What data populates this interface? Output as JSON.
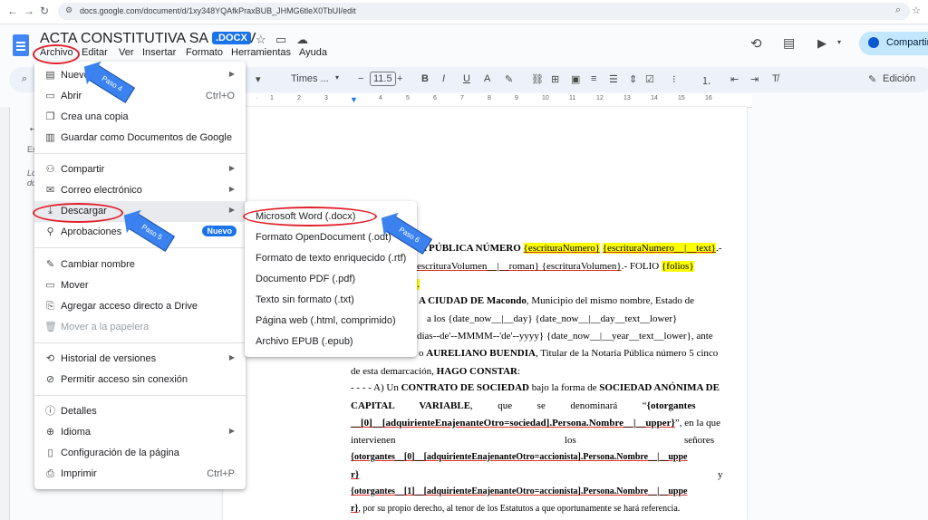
{
  "browser": {
    "url": "docs.google.com/document/d/1xy348YQAfkPraxBUB_JHMG6tleX0TbUI/edit"
  },
  "header": {
    "title": "ACTA CONSTITUTIVA SA DE CV",
    "badge": ".DOCX",
    "share_label": "Compartir"
  },
  "menubar": [
    "Archivo",
    "Editar",
    "Ver",
    "Insertar",
    "Formato",
    "Herramientas",
    "Ayuda"
  ],
  "toolbar": {
    "font": "Times ...",
    "font_size": "11.5",
    "mode": "Edición"
  },
  "ruler_ticks": [
    "1",
    "2",
    "3",
    "4",
    "5",
    "6",
    "7",
    "8",
    "9",
    "10",
    "11",
    "12",
    "13",
    "14",
    "15",
    "16"
  ],
  "file_menu": [
    {
      "label": "Nuevo",
      "icon": "new-doc-icon",
      "arrow": true
    },
    {
      "label": "Abrir",
      "icon": "folder-icon",
      "shortcut": "Ctrl+O"
    },
    {
      "label": "Crea una copia",
      "icon": "copy-icon"
    },
    {
      "label": "Guardar como Documentos de Google",
      "icon": "doc-icon"
    },
    {
      "label": "Compartir",
      "icon": "share-person-icon",
      "arrow": true
    },
    {
      "label": "Correo electrónico",
      "icon": "mail-icon",
      "arrow": true
    },
    {
      "label": "Descargar",
      "icon": "download-icon",
      "arrow": true
    },
    {
      "label": "Aprobaciones",
      "icon": "approvals-icon",
      "badge": "Nuevo"
    },
    {
      "label": "Cambiar nombre",
      "icon": "rename-icon"
    },
    {
      "label": "Mover",
      "icon": "move-folder-icon"
    },
    {
      "label": "Agregar acceso directo a Drive",
      "icon": "drive-shortcut-icon"
    },
    {
      "label": "Mover a la papelera",
      "icon": "trash-icon",
      "disabled": true
    },
    {
      "label": "Historial de versiones",
      "icon": "history-icon",
      "arrow": true
    },
    {
      "label": "Permitir acceso sin conexión",
      "icon": "offline-icon"
    },
    {
      "label": "Detalles",
      "icon": "info-icon"
    },
    {
      "label": "Idioma",
      "icon": "globe-icon",
      "arrow": true
    },
    {
      "label": "Configuración de la página",
      "icon": "page-setup-icon"
    },
    {
      "label": "Imprimir",
      "icon": "print-icon",
      "shortcut": "Ctrl+P"
    }
  ],
  "download_menu": [
    "Microsoft Word (.docx)",
    "Formato OpenDocument (.odt)",
    "Formato de texto enriquecido (.rtf)",
    "Documento PDF (.pdf)",
    "Texto sin formato (.txt)",
    "Página web (.html, comprimido)",
    "Archivo EPUB (.epub)"
  ],
  "annotations": {
    "step4": "Paso 4",
    "step5": "Paso 5",
    "step6": "Paso 6"
  },
  "document_lines": {
    "l1a": "RA PÚBLICA NÚMERO ",
    "l1b": "{escrituraNumero}",
    "l1c": " ",
    "l1d": "{escrituraNumero__|__text}",
    "l1e": ".-",
    "l2a": "escrituraVolumen__|__roman}  ",
    "l2b": "{escrituraVolumen}",
    "l2c": ".-  FOLIO  ",
    "l2d": "{folios}",
    "l3": "}.",
    "l4a": "A CIUDAD DE Macondo",
    "l4b": ", Municipio del mismo nombre, Estado de",
    "l5": "a      los      {date_now__|__day}      {date_now__|__day__text__lower}",
    "l6": "'días--de'--MMMM--'de'--yyyy}  {date_now__|__year__text__lower},  ante",
    "l7a": "o ",
    "l7b": "AURELIANO BUENDIA",
    "l7c": ", Titular de la Notaría Pública número 5 cinco",
    "l8a": "de esta demarcación, ",
    "l8b": "HAGO CONSTAR",
    "l8c": ":",
    "l9a": "- - - - A) Un ",
    "l9b": "CONTRATO DE SOCIEDAD",
    "l9c": " bajo la forma de ",
    "l9d": "SOCIEDAD ANÓNIMA DE",
    "l10a": "CAPITAL          VARIABLE",
    "l10b": ",          que          se          denominará          “",
    "l10c": "{otorgantes",
    "l11a": "__[0]__[adquirienteEnajenanteOtro=sociedad].Persona.Nombre__|__upper}",
    "l11b": "”, en la que",
    "l12a": "intervienen",
    "l12b": "los",
    "l12c": "señores",
    "l13": "{otorgantes__[0]__[adquirienteEnajenanteOtro=accionista].Persona.Nombre__|__uppe",
    "l14a": "r}",
    "l14b": "y",
    "l15": "{otorgantes__[1]__[adquirienteEnajenanteOtro=accionista].Persona.Nombre__|__uppe",
    "l16a": "r}",
    "l16b": ", por su propio derecho, al tenor de los Estatutos a que oportunamente se hará referencia."
  },
  "side_panel": {
    "tab_letter": "Es",
    "hint1": "Lo",
    "hint2": "do"
  }
}
